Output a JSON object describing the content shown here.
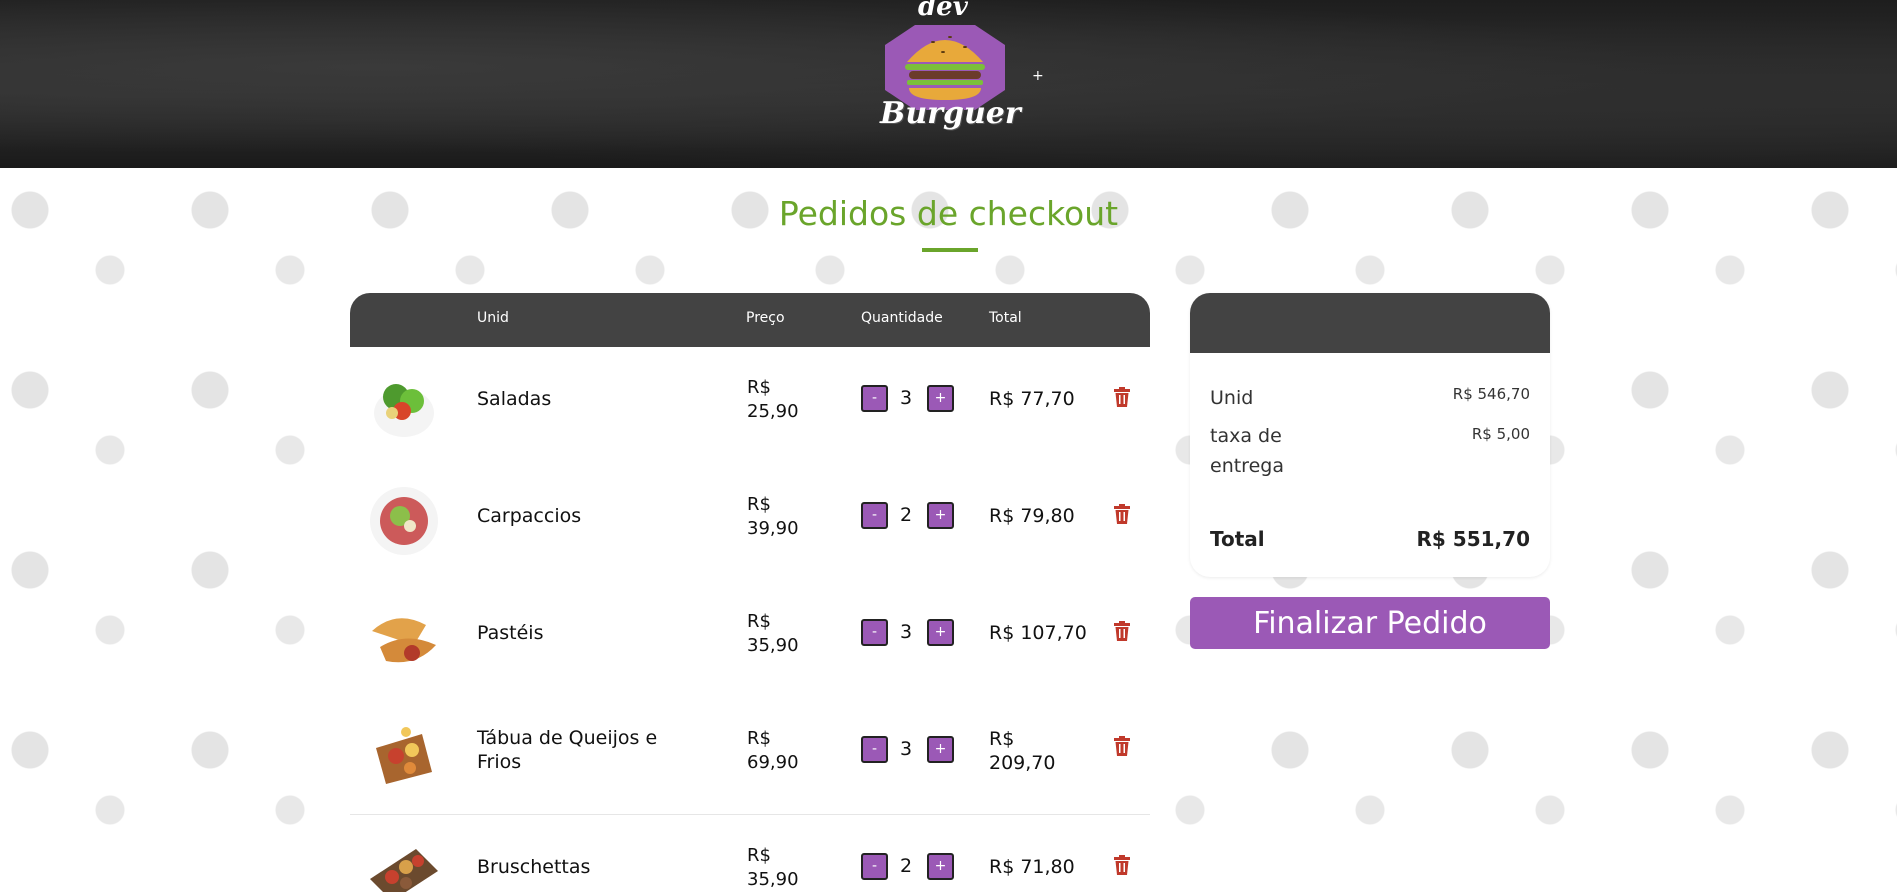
{
  "header": {
    "logo_top": "dev",
    "logo_bottom": "Burguer",
    "plus_mark": "+"
  },
  "page": {
    "title": "Pedidos de checkout"
  },
  "table": {
    "columns": {
      "unit": "Unid",
      "price": "Preço",
      "quantity": "Quantidade",
      "total": "Total"
    },
    "rows": [
      {
        "name": "Saladas",
        "price_line1": "R$",
        "price_line2": "25,90",
        "quantity": "3",
        "total": "R$ 77,70"
      },
      {
        "name": "Carpaccios",
        "price_line1": "R$",
        "price_line2": "39,90",
        "quantity": "2",
        "total": "R$ 79,80"
      },
      {
        "name": "Pastéis",
        "price_line1": "R$",
        "price_line2": "35,90",
        "quantity": "3",
        "total": "R$ 107,70"
      },
      {
        "name": "Tábua de Queijos e Frios",
        "price_line1": "R$",
        "price_line2": "69,90",
        "quantity": "3",
        "total": "R$ 209,70"
      },
      {
        "name": "Bruschettas",
        "price_line1": "R$",
        "price_line2": "35,90",
        "quantity": "2",
        "total": "R$ 71,80"
      }
    ],
    "minus_label": "-",
    "plus_label": "+"
  },
  "summary": {
    "subtotal_label": "Unid",
    "subtotal_value": "R$ 546,70",
    "delivery_label": "taxa de entrega",
    "delivery_value": "R$ 5,00",
    "total_label": "Total",
    "total_value": "R$ 551,70",
    "finalize_label": "Finalizar Pedido"
  },
  "colors": {
    "accent_purple": "#9b59b6",
    "title_green": "#6aa52b",
    "header_dark": "#434343",
    "trash_red": "#c0392b"
  },
  "icons": {
    "logo": "burger-logo-icon",
    "delete": "trash-icon"
  }
}
